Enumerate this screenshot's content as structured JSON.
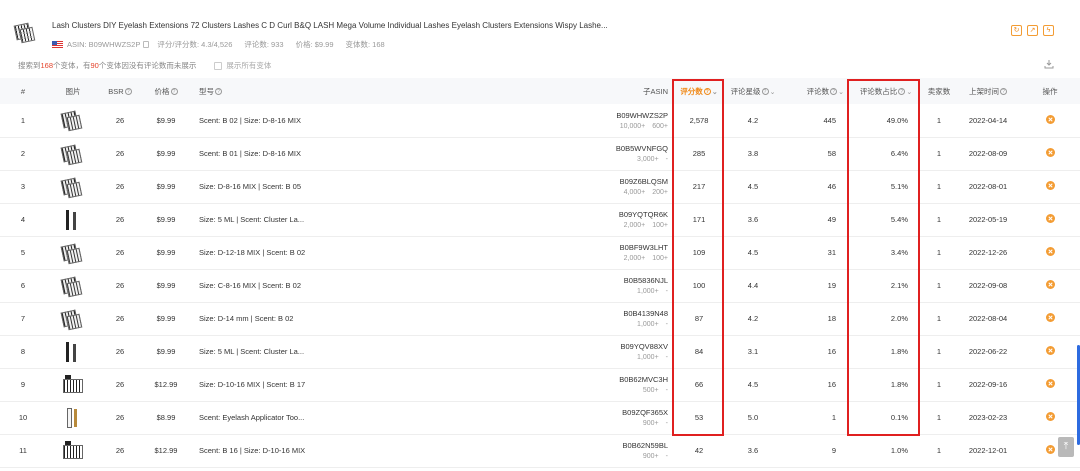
{
  "product": {
    "title": "Lash Clusters DIY Eyelash Extensions 72 Clusters Lashes C D Curl B&Q LASH Mega Volume Individual Lashes Eyelash Clusters Extensions Wispy Lashe...",
    "asin_label": "ASIN: B09WHWZS2P",
    "rating_label": "评分/评分数: 4.3/4,526",
    "reviews_label": "评论数: 933",
    "price_label": "价格: $9.99",
    "variants_label": "变体数: 168"
  },
  "header_actions": [
    "refresh-icon",
    "share-icon",
    "bolt-icon"
  ],
  "info_bar": {
    "prefix": "搜索到",
    "variant_count": "168",
    "middle": "个变体，有",
    "no_review_count": "90",
    "suffix": "个变体因没有评论数而未展示",
    "checkbox_label": "展示所有变体"
  },
  "columns": {
    "index": "#",
    "image": "图片",
    "bsr": "BSR",
    "price": "价格",
    "model": "型号",
    "child_asin": "子ASIN",
    "rating_count": "评分数",
    "star_rating": "评论星级",
    "review_count": "评论数",
    "review_share": "评论数占比",
    "sellers": "卖家数",
    "listed_date": "上架时间",
    "actions": "操作"
  },
  "rows": [
    {
      "idx": "1",
      "img": "tray",
      "bsr": "26",
      "price": "$9.99",
      "model": "Scent: B 02 | Size: D-8-16 MIX",
      "asin": "B09WHWZS2P",
      "sub1": "10,000+",
      "sub2": "600+",
      "rating_count": "2,578",
      "stars": "4.2",
      "reviews": "445",
      "share": "49.0%",
      "sellers": "1",
      "date": "2022-04-14"
    },
    {
      "idx": "2",
      "img": "tray",
      "bsr": "26",
      "price": "$9.99",
      "model": "Scent: B 01 | Size: D-8-16 MIX",
      "asin": "B0B5WVNFGQ",
      "sub1": "3,000+",
      "sub2": "-",
      "rating_count": "285",
      "stars": "3.8",
      "reviews": "58",
      "share": "6.4%",
      "sellers": "1",
      "date": "2022-08-09"
    },
    {
      "idx": "3",
      "img": "tray",
      "bsr": "26",
      "price": "$9.99",
      "model": "Size: D-8-16 MIX | Scent: B 05",
      "asin": "B09Z6BLQSM",
      "sub1": "4,000+",
      "sub2": "200+",
      "rating_count": "217",
      "stars": "4.5",
      "reviews": "46",
      "share": "5.1%",
      "sellers": "1",
      "date": "2022-08-01"
    },
    {
      "idx": "4",
      "img": "wand",
      "bsr": "26",
      "price": "$9.99",
      "model": "Size: 5 ML | Scent: Cluster La...",
      "asin": "B09YQTQR6K",
      "sub1": "2,000+",
      "sub2": "100+",
      "rating_count": "171",
      "stars": "3.6",
      "reviews": "49",
      "share": "5.4%",
      "sellers": "1",
      "date": "2022-05-19"
    },
    {
      "idx": "5",
      "img": "tray",
      "bsr": "26",
      "price": "$9.99",
      "model": "Size: D-12-18 MIX | Scent: B 02",
      "asin": "B0BF9W3LHT",
      "sub1": "2,000+",
      "sub2": "100+",
      "rating_count": "109",
      "stars": "4.5",
      "reviews": "31",
      "share": "3.4%",
      "sellers": "1",
      "date": "2022-12-26"
    },
    {
      "idx": "6",
      "img": "tray",
      "bsr": "26",
      "price": "$9.99",
      "model": "Size: C-8-16 MIX | Scent: B 02",
      "asin": "B0B5836NJL",
      "sub1": "1,000+",
      "sub2": "-",
      "rating_count": "100",
      "stars": "4.4",
      "reviews": "19",
      "share": "2.1%",
      "sellers": "1",
      "date": "2022-09-08"
    },
    {
      "idx": "7",
      "img": "tray",
      "bsr": "26",
      "price": "$9.99",
      "model": "Size: D-14 mm | Scent: B 02",
      "asin": "B0B4139N48",
      "sub1": "1,000+",
      "sub2": "-",
      "rating_count": "87",
      "stars": "4.2",
      "reviews": "18",
      "share": "2.0%",
      "sellers": "1",
      "date": "2022-08-04"
    },
    {
      "idx": "8",
      "img": "wand",
      "bsr": "26",
      "price": "$9.99",
      "model": "Size: 5 ML | Scent: Cluster La...",
      "asin": "B09YQV88XV",
      "sub1": "1,000+",
      "sub2": "-",
      "rating_count": "84",
      "stars": "3.1",
      "reviews": "16",
      "share": "1.8%",
      "sellers": "1",
      "date": "2022-06-22"
    },
    {
      "idx": "9",
      "img": "sq",
      "bsr": "26",
      "price": "$12.99",
      "model": "Size: D-10-16 MIX | Scent: B 17",
      "asin": "B0B62MVC3H",
      "sub1": "500+",
      "sub2": "-",
      "rating_count": "66",
      "stars": "4.5",
      "reviews": "16",
      "share": "1.8%",
      "sellers": "1",
      "date": "2022-09-16"
    },
    {
      "idx": "10",
      "img": "tube",
      "bsr": "26",
      "price": "$8.99",
      "model": "Scent: Eyelash Applicator Too...",
      "asin": "B09ZQF365X",
      "sub1": "900+",
      "sub2": "-",
      "rating_count": "53",
      "stars": "5.0",
      "reviews": "1",
      "share": "0.1%",
      "sellers": "1",
      "date": "2023-02-23"
    },
    {
      "idx": "11",
      "img": "sq",
      "bsr": "26",
      "price": "$12.99",
      "model": "Scent: B 16 | Size: D-10-16 MIX",
      "asin": "B0B62N59BL",
      "sub1": "900+",
      "sub2": "-",
      "rating_count": "42",
      "stars": "3.6",
      "reviews": "9",
      "share": "1.0%",
      "sellers": "1",
      "date": "2022-12-01"
    }
  ],
  "colors": {
    "accent": "#f08a1a",
    "highlight": "#e02020",
    "percent": "#e4432b"
  }
}
